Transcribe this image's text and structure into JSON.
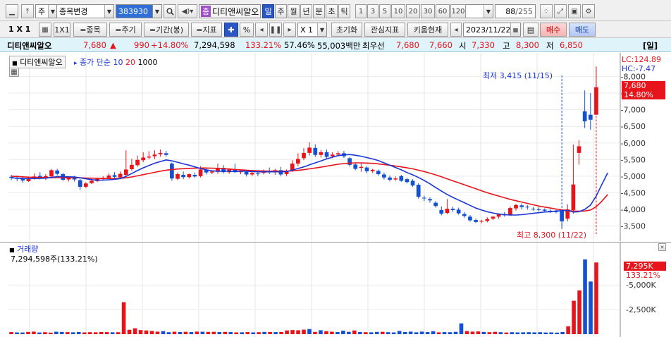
{
  "toolbar1": {
    "period_type": "주",
    "stock_change": "종목변경",
    "code": "383930",
    "stock_name": "디티앤씨알오",
    "name_badge": "종",
    "periods": [
      "일",
      "주",
      "월",
      "년",
      "분",
      "초",
      "틱"
    ],
    "active_period": "일",
    "minutes": [
      "1",
      "3",
      "5",
      "10",
      "20",
      "30",
      "60",
      "120"
    ],
    "count_current": "88",
    "count_total": "/255"
  },
  "toolbar2": {
    "scale_label": "1 X 1",
    "tab_1x1": "1X1",
    "btn_item": "=종목",
    "btn_cycle": "=주기",
    "btn_range": "=기간(봉)",
    "btn_indicator": "=지표",
    "btn_percent": "%",
    "zoom_value": "X 1",
    "btn_reset": "초기화",
    "btn_watch": "관심지표",
    "btn_kiwoom": "키움현재",
    "date_value": "2023/11/22",
    "btn_buy": "매수",
    "btn_sell": "매도"
  },
  "quote": {
    "name": "디티앤씨알오",
    "price": "7,680",
    "change": "990",
    "change_pct": "+14.80%",
    "volume": "7,294,598",
    "vol_ratio": "133.21%",
    "turnover_pct": "57.46%",
    "amount": "55,003백만",
    "best_quote_label": "최우선",
    "best_ask": "7,680",
    "best_bid": "7,660",
    "open_label": "시",
    "open": "7,330",
    "high_label": "고",
    "high": "8,300",
    "low_label": "저",
    "low": "6,850",
    "day_tag": "[일]"
  },
  "price_panel": {
    "stock_tag": "디티앤씨알오",
    "ma_legend_prefix": "종가 단순",
    "ma1_label": "10",
    "ma2_label": "20",
    "ma3_label": "1000",
    "lc": "LC:124.89",
    "hc": "HC:-7.47",
    "price_tag": "7,680",
    "pct_tag": "14.80%",
    "min_annotation": "최저 3,415 (11/15)",
    "max_annotation": "최고 8,300 (11/22)"
  },
  "volume_panel": {
    "title": "거래량",
    "value_text": "7,294,598주(133.21%)",
    "tag_value": "7,295K",
    "tag_pct": "133.21%"
  },
  "colors": {
    "up": "#e8141b",
    "down": "#1450d2",
    "ma10": "#1a36d6",
    "ma20": "#e8141b"
  },
  "chart_data": [
    {
      "type": "candlestick",
      "title": "",
      "y_ticks": [
        8000,
        7500,
        7000,
        6500,
        6000,
        5500,
        5000,
        4500,
        4000,
        3500
      ],
      "ylim": [
        3150,
        8500
      ],
      "candles": [
        {
          "o": 4980,
          "h": 5040,
          "c": 4950,
          "l": 4880
        },
        {
          "o": 4950,
          "h": 5020,
          "c": 4920,
          "l": 4850
        },
        {
          "o": 4940,
          "h": 5000,
          "c": 4870,
          "l": 4800
        },
        {
          "o": 4850,
          "h": 4990,
          "c": 4940,
          "l": 4830
        },
        {
          "o": 4930,
          "h": 5080,
          "c": 4990,
          "l": 4900
        },
        {
          "o": 5010,
          "h": 5120,
          "c": 4940,
          "l": 4900
        },
        {
          "o": 4940,
          "h": 5060,
          "c": 5000,
          "l": 4880
        },
        {
          "o": 4990,
          "h": 5220,
          "c": 5180,
          "l": 4950
        },
        {
          "o": 5170,
          "h": 5220,
          "c": 5070,
          "l": 5020
        },
        {
          "o": 5060,
          "h": 5100,
          "c": 4890,
          "l": 4860
        },
        {
          "o": 4900,
          "h": 4990,
          "c": 4980,
          "l": 4840
        },
        {
          "o": 4960,
          "h": 5010,
          "c": 4900,
          "l": 4840
        },
        {
          "o": 4880,
          "h": 4920,
          "c": 4680,
          "l": 4590
        },
        {
          "o": 4680,
          "h": 4820,
          "c": 4780,
          "l": 4640
        },
        {
          "o": 4790,
          "h": 4920,
          "c": 4860,
          "l": 4760
        },
        {
          "o": 4850,
          "h": 4950,
          "c": 4920,
          "l": 4820
        },
        {
          "o": 4910,
          "h": 5000,
          "c": 4950,
          "l": 4880
        },
        {
          "o": 4950,
          "h": 5080,
          "c": 5020,
          "l": 4920
        },
        {
          "o": 5030,
          "h": 5120,
          "c": 4980,
          "l": 4920
        },
        {
          "o": 4960,
          "h": 5140,
          "c": 5070,
          "l": 4930
        },
        {
          "o": 5040,
          "h": 5780,
          "c": 5200,
          "l": 4990
        },
        {
          "o": 5210,
          "h": 5520,
          "c": 5340,
          "l": 5160
        },
        {
          "o": 5330,
          "h": 5620,
          "c": 5490,
          "l": 5280
        },
        {
          "o": 5480,
          "h": 5720,
          "c": 5560,
          "l": 5420
        },
        {
          "o": 5560,
          "h": 5750,
          "c": 5590,
          "l": 5510
        },
        {
          "o": 5600,
          "h": 5780,
          "c": 5650,
          "l": 5520
        },
        {
          "o": 5660,
          "h": 5800,
          "c": 5700,
          "l": 5590
        },
        {
          "o": 5690,
          "h": 5760,
          "c": 5640,
          "l": 5590
        },
        {
          "o": 5380,
          "h": 5410,
          "c": 4930,
          "l": 4860
        },
        {
          "o": 4920,
          "h": 5110,
          "c": 5060,
          "l": 4880
        },
        {
          "o": 5040,
          "h": 5140,
          "c": 4970,
          "l": 4910
        },
        {
          "o": 4970,
          "h": 5080,
          "c": 5060,
          "l": 4930
        },
        {
          "o": 5040,
          "h": 5110,
          "c": 4990,
          "l": 4950
        },
        {
          "o": 5000,
          "h": 5300,
          "c": 5200,
          "l": 4960
        },
        {
          "o": 5190,
          "h": 5260,
          "c": 5110,
          "l": 5050
        },
        {
          "o": 5110,
          "h": 5170,
          "c": 5140,
          "l": 5060
        },
        {
          "o": 5130,
          "h": 5380,
          "c": 5240,
          "l": 5070
        },
        {
          "o": 5250,
          "h": 5330,
          "c": 5120,
          "l": 5080
        },
        {
          "o": 5120,
          "h": 5230,
          "c": 5200,
          "l": 5070
        },
        {
          "o": 5200,
          "h": 5380,
          "c": 5120,
          "l": 5100
        },
        {
          "o": 5120,
          "h": 5200,
          "c": 5160,
          "l": 5060
        },
        {
          "o": 5130,
          "h": 5190,
          "c": 5050,
          "l": 4990
        },
        {
          "o": 5050,
          "h": 5130,
          "c": 5100,
          "l": 5000
        },
        {
          "o": 5080,
          "h": 5160,
          "c": 5060,
          "l": 5000
        },
        {
          "o": 5100,
          "h": 5200,
          "c": 5150,
          "l": 5050
        },
        {
          "o": 5140,
          "h": 5260,
          "c": 5120,
          "l": 5060
        },
        {
          "o": 5120,
          "h": 5220,
          "c": 5180,
          "l": 5040
        },
        {
          "o": 5180,
          "h": 5280,
          "c": 5050,
          "l": 5000
        },
        {
          "o": 5060,
          "h": 5200,
          "c": 5150,
          "l": 5000
        },
        {
          "o": 5160,
          "h": 5480,
          "c": 5380,
          "l": 5130
        },
        {
          "o": 5380,
          "h": 5690,
          "c": 5520,
          "l": 5300
        },
        {
          "o": 5540,
          "h": 5850,
          "c": 5700,
          "l": 5480
        },
        {
          "o": 5700,
          "h": 6020,
          "c": 5860,
          "l": 5620
        },
        {
          "o": 5850,
          "h": 5960,
          "c": 5640,
          "l": 5580
        },
        {
          "o": 5640,
          "h": 5790,
          "c": 5720,
          "l": 5560
        },
        {
          "o": 5720,
          "h": 5800,
          "c": 5580,
          "l": 5520
        },
        {
          "o": 5600,
          "h": 5720,
          "c": 5650,
          "l": 5540
        },
        {
          "o": 5650,
          "h": 5750,
          "c": 5690,
          "l": 5600
        },
        {
          "o": 5690,
          "h": 5760,
          "c": 5600,
          "l": 5550
        },
        {
          "o": 5540,
          "h": 5580,
          "c": 5340,
          "l": 5290
        },
        {
          "o": 5350,
          "h": 5410,
          "c": 5220,
          "l": 5180
        },
        {
          "o": 5250,
          "h": 5400,
          "c": 5280,
          "l": 5130
        },
        {
          "o": 5260,
          "h": 5300,
          "c": 5150,
          "l": 5090
        },
        {
          "o": 5150,
          "h": 5220,
          "c": 5190,
          "l": 5100
        },
        {
          "o": 5160,
          "h": 5200,
          "c": 5060,
          "l": 5010
        },
        {
          "o": 5050,
          "h": 5110,
          "c": 4960,
          "l": 4900
        },
        {
          "o": 4960,
          "h": 5020,
          "c": 4890,
          "l": 4840
        },
        {
          "o": 4900,
          "h": 4990,
          "c": 4930,
          "l": 4860
        },
        {
          "o": 5000,
          "h": 5040,
          "c": 4860,
          "l": 4830
        },
        {
          "o": 4910,
          "h": 4950,
          "c": 4820,
          "l": 4780
        },
        {
          "o": 4860,
          "h": 4910,
          "c": 4720,
          "l": 4680
        },
        {
          "o": 4740,
          "h": 4790,
          "c": 4380,
          "l": 4320
        },
        {
          "o": 4350,
          "h": 4410,
          "c": 4330,
          "l": 4250
        },
        {
          "o": 4310,
          "h": 4360,
          "c": 4270,
          "l": 4200
        },
        {
          "o": 4200,
          "h": 4250,
          "c": 4100,
          "l": 4050
        },
        {
          "o": 3980,
          "h": 4090,
          "c": 3870,
          "l": 3820
        },
        {
          "o": 3890,
          "h": 4310,
          "c": 4020,
          "l": 3850
        },
        {
          "o": 4020,
          "h": 4080,
          "c": 3980,
          "l": 3920
        },
        {
          "o": 3990,
          "h": 4050,
          "c": 3880,
          "l": 3840
        },
        {
          "o": 3860,
          "h": 3920,
          "c": 3800,
          "l": 3750
        },
        {
          "o": 3780,
          "h": 3830,
          "c": 3670,
          "l": 3630
        },
        {
          "o": 3680,
          "h": 3720,
          "c": 3620,
          "l": 3590
        },
        {
          "o": 3630,
          "h": 3690,
          "c": 3650,
          "l": 3580
        },
        {
          "o": 3650,
          "h": 3760,
          "c": 3710,
          "l": 3610
        },
        {
          "o": 3720,
          "h": 3800,
          "c": 3780,
          "l": 3680
        },
        {
          "o": 3780,
          "h": 3880,
          "c": 3860,
          "l": 3720
        },
        {
          "o": 3860,
          "h": 3920,
          "c": 3820,
          "l": 3780
        },
        {
          "o": 3830,
          "h": 4090,
          "c": 4040,
          "l": 3810
        },
        {
          "o": 4030,
          "h": 4170,
          "c": 4130,
          "l": 3960
        },
        {
          "o": 4120,
          "h": 4180,
          "c": 4070,
          "l": 4000
        },
        {
          "o": 4080,
          "h": 4130,
          "c": 4060,
          "l": 3990
        },
        {
          "o": 4020,
          "h": 4070,
          "c": 4000,
          "l": 3960
        },
        {
          "o": 4000,
          "h": 4060,
          "c": 3980,
          "l": 3940
        },
        {
          "o": 3990,
          "h": 4030,
          "c": 3960,
          "l": 3920
        },
        {
          "o": 3960,
          "h": 4000,
          "c": 3940,
          "l": 3890
        },
        {
          "o": 3940,
          "h": 3990,
          "c": 3920,
          "l": 3880
        },
        {
          "o": 3950,
          "h": 4000,
          "c": 3640,
          "l": 3415
        },
        {
          "o": 3720,
          "h": 4150,
          "c": 4000,
          "l": 3640
        },
        {
          "o": 3980,
          "h": 5950,
          "c": 4750,
          "l": 3870
        },
        {
          "o": 5700,
          "h": 6080,
          "c": 5900,
          "l": 5350
        },
        {
          "o": 6950,
          "h": 7580,
          "c": 6650,
          "l": 6450
        },
        {
          "o": 6850,
          "h": 7500,
          "c": 6700,
          "l": 6400
        },
        {
          "o": 6850,
          "h": 8300,
          "c": 7680,
          "l": 6850
        }
      ],
      "ma10": [
        4950,
        4940,
        4930,
        4925,
        4930,
        4935,
        4940,
        4960,
        4985,
        4985,
        4980,
        4975,
        4950,
        4920,
        4895,
        4880,
        4880,
        4890,
        4905,
        4925,
        4990,
        5080,
        5170,
        5250,
        5320,
        5390,
        5440,
        5490,
        5460,
        5420,
        5370,
        5330,
        5280,
        5230,
        5190,
        5160,
        5150,
        5150,
        5150,
        5140,
        5150,
        5150,
        5140,
        5130,
        5130,
        5130,
        5130,
        5130,
        5140,
        5180,
        5230,
        5280,
        5340,
        5400,
        5460,
        5520,
        5570,
        5620,
        5640,
        5650,
        5630,
        5600,
        5560,
        5520,
        5470,
        5400,
        5330,
        5260,
        5190,
        5110,
        5040,
        4960,
        4870,
        4770,
        4660,
        4550,
        4450,
        4360,
        4280,
        4200,
        4120,
        4040,
        3980,
        3930,
        3890,
        3860,
        3840,
        3830,
        3830,
        3840,
        3860,
        3880,
        3900,
        3920,
        3930,
        3950,
        3960,
        3970,
        3920,
        3930,
        4000,
        4130,
        4400,
        4760,
        5100
      ],
      "ma20": [
        5000,
        4990,
        4980,
        4970,
        4965,
        4960,
        4958,
        4955,
        4955,
        4955,
        4955,
        4955,
        4950,
        4945,
        4940,
        4935,
        4930,
        4928,
        4930,
        4935,
        4950,
        4975,
        5010,
        5045,
        5080,
        5115,
        5150,
        5180,
        5200,
        5215,
        5225,
        5235,
        5240,
        5245,
        5245,
        5240,
        5235,
        5225,
        5215,
        5200,
        5190,
        5180,
        5170,
        5160,
        5155,
        5150,
        5150,
        5150,
        5150,
        5160,
        5175,
        5195,
        5220,
        5245,
        5270,
        5300,
        5330,
        5360,
        5380,
        5395,
        5400,
        5400,
        5395,
        5385,
        5370,
        5350,
        5330,
        5305,
        5280,
        5250,
        5220,
        5180,
        5140,
        5090,
        5040,
        4980,
        4920,
        4860,
        4800,
        4740,
        4680,
        4620,
        4560,
        4500,
        4450,
        4400,
        4350,
        4300,
        4260,
        4220,
        4180,
        4140,
        4100,
        4070,
        4040,
        4010,
        3985,
        3965,
        3950,
        3945,
        3950,
        3980,
        4080,
        4250,
        4450
      ]
    },
    {
      "type": "bar",
      "title": "거래량",
      "y_ticks_label": [
        "7,295K",
        "5,000K",
        "2,500K"
      ],
      "y_ticks": [
        7295,
        5000,
        2500
      ],
      "ylim": [
        0,
        8600
      ],
      "values": [
        210,
        180,
        170,
        230,
        260,
        170,
        200,
        160,
        250,
        230,
        210,
        190,
        220,
        180,
        200,
        190,
        220,
        210,
        190,
        200,
        3250,
        450,
        600,
        420,
        380,
        330,
        260,
        310,
        200,
        250,
        220,
        240,
        210,
        260,
        250,
        230,
        240,
        210,
        230,
        210,
        180,
        190,
        210,
        180,
        200,
        230,
        220,
        210,
        220,
        380,
        420,
        400,
        460,
        520,
        230,
        400,
        300,
        250,
        220,
        360,
        240,
        380,
        220,
        200,
        190,
        230,
        240,
        200,
        180,
        330,
        220,
        260,
        190,
        260,
        210,
        300,
        190,
        210,
        200,
        240,
        1100,
        320,
        260,
        280,
        230,
        200,
        240,
        200,
        170,
        200,
        180,
        190,
        200,
        180,
        200,
        170,
        180,
        160,
        220,
        800,
        3400,
        4450,
        7600,
        5350,
        7290
      ],
      "colors_up": [
        1,
        0,
        0,
        1,
        1,
        0,
        1,
        1,
        0,
        0,
        1,
        0,
        0,
        1,
        1,
        1,
        1,
        1,
        0,
        1,
        1,
        1,
        1,
        1,
        1,
        1,
        1,
        0,
        0,
        1,
        0,
        1,
        0,
        1,
        0,
        1,
        1,
        0,
        1,
        0,
        1,
        0,
        1,
        0,
        1,
        0,
        1,
        0,
        1,
        1,
        1,
        1,
        1,
        0,
        1,
        0,
        1,
        1,
        0,
        0,
        0,
        1,
        0,
        1,
        0,
        0,
        1,
        0,
        0,
        0,
        0,
        0,
        0,
        0,
        0,
        0,
        1,
        0,
        0,
        0,
        0,
        1,
        1,
        1,
        0,
        1,
        1,
        0,
        1,
        0,
        0,
        0,
        0,
        0,
        0,
        0,
        0,
        0,
        0,
        1,
        1,
        1,
        0,
        0,
        1
      ]
    }
  ]
}
